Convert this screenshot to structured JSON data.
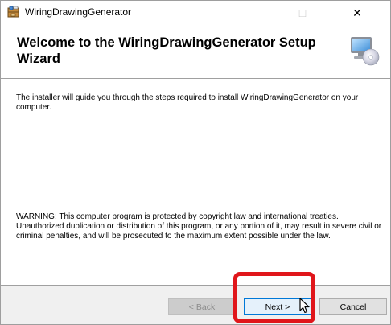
{
  "window": {
    "title": "WiringDrawingGenerator",
    "controls": {
      "minimize": "–",
      "maximize": "□",
      "close": "✕"
    }
  },
  "banner": {
    "title": "Welcome to the WiringDrawingGenerator Setup Wizard",
    "icon": "computer-disc-icon"
  },
  "body": {
    "intro": "The installer will guide you through the steps required to install WiringDrawingGenerator on your computer.",
    "warning": "WARNING: This computer program is protected by copyright law and international treaties. Unauthorized duplication or distribution of this program, or any portion of it, may result in severe civil or criminal penalties, and will be prosecuted to the maximum extent possible under the law."
  },
  "buttons": {
    "back": "< Back",
    "next": "Next >",
    "cancel": "Cancel"
  },
  "colors": {
    "highlight": "#e0161b",
    "next_border": "#0078d7"
  }
}
